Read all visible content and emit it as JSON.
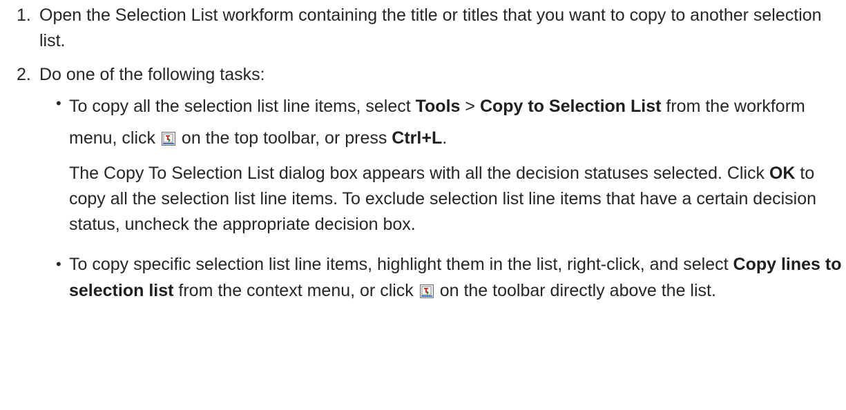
{
  "steps": [
    {
      "num": "1.",
      "text": "Open the Selection List workform containing the title or titles that you want to copy to another selection list."
    },
    {
      "num": "2.",
      "text": "Do one of the following tasks:",
      "tasks": [
        {
          "bullet": "•",
          "t1": "To copy all the selection list line items, select ",
          "b1": "Tools",
          "t2": " > ",
          "b2": "Copy to Selection List",
          "t3": " from the workform menu, click ",
          "t4": " on the top toolbar, or press ",
          "b3": "Ctrl+L",
          "t5": ".",
          "note_t1": "The Copy To Selection List dialog box appears with all the decision statuses selected. Click ",
          "note_b1": "OK",
          "note_t2": " to copy all the selection list line items. To exclude selection list line items that have a certain decision status, uncheck the appropriate decision box."
        },
        {
          "bullet": "•",
          "t1": "To copy specific selection list line items, highlight them in the list, right-click, and select ",
          "b1": "Copy lines to selection list",
          "t2": " from the context menu, or click ",
          "t3": " on the toolbar directly above the list."
        }
      ]
    }
  ],
  "icons": {
    "toolbar_icon": "copy-to-selection-list-icon"
  }
}
